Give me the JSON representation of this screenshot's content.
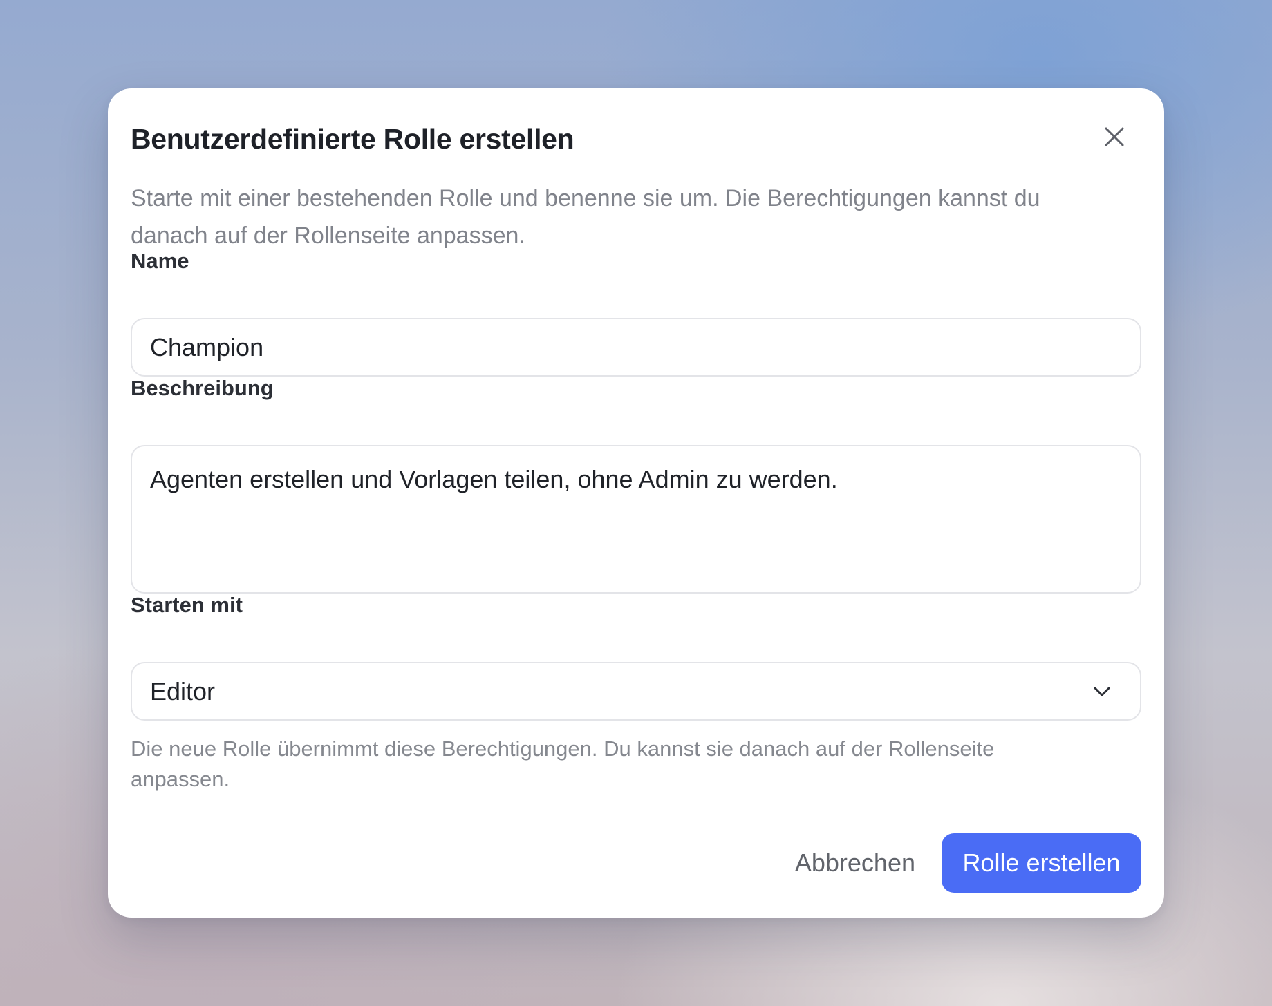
{
  "dialog": {
    "title": "Benutzerdefinierte Rolle erstellen",
    "subtitle": "Starte mit einer bestehenden Rolle und benenne sie um. Die Berechtigungen kannst du danach auf der Rollenseite anpassen.",
    "close_icon": "close-icon"
  },
  "form": {
    "name": {
      "label": "Name",
      "value": "Champion"
    },
    "description": {
      "label": "Beschreibung",
      "value": "Agenten erstellen und Vorlagen teilen, ohne Admin zu werden."
    },
    "start_with": {
      "label": "Starten mit",
      "selected": "Editor",
      "icon": "chevron-down-icon",
      "helper": "Die neue Rolle übernimmt diese Berechtigungen. Du kannst sie danach auf der Rollenseite anpassen."
    }
  },
  "actions": {
    "cancel_label": "Abbrechen",
    "submit_label": "Rolle erstellen",
    "submit_color": "#4a6cf5"
  }
}
